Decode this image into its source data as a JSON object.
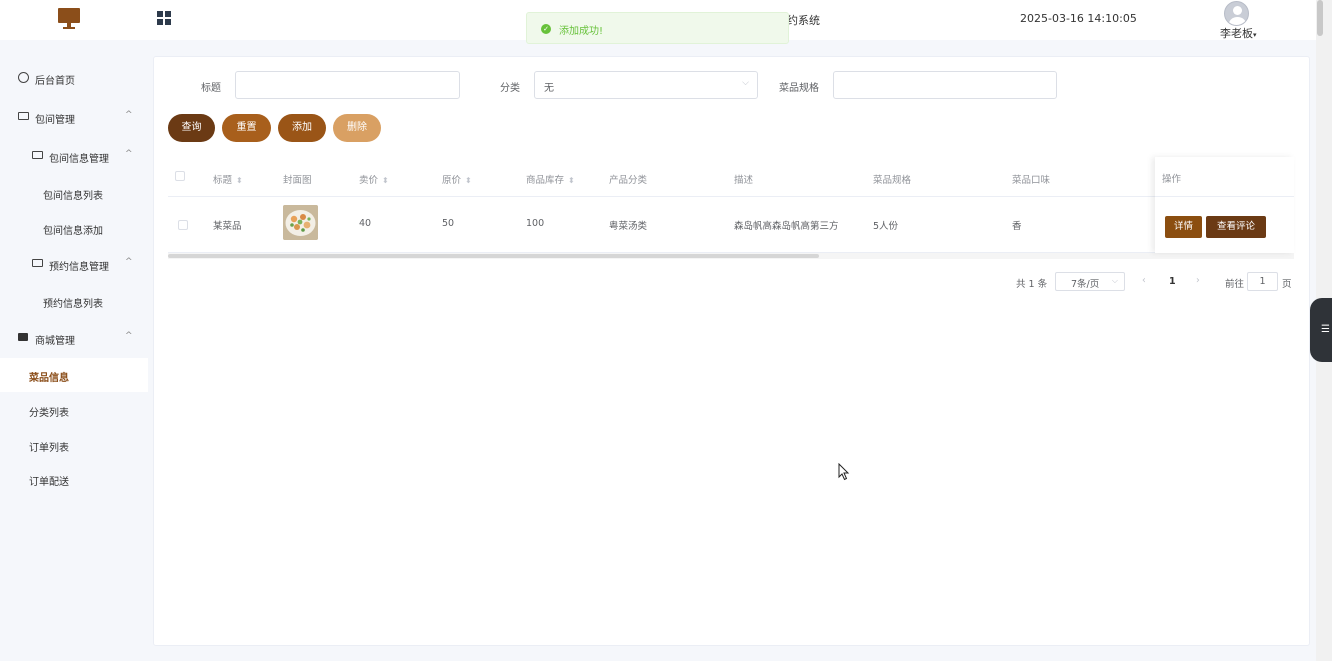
{
  "header": {
    "system_title": "约系统",
    "datetime": "2025-03-16 14:10:05",
    "username": "李老板",
    "toast": "添加成功!"
  },
  "sidebar": {
    "items": [
      {
        "label": "后台首页",
        "icon": "clock-icon"
      },
      {
        "label": "包间管理",
        "icon": "room-icon"
      },
      {
        "label": "包间信息管理",
        "icon": "info-icon"
      },
      {
        "label": "包间信息列表"
      },
      {
        "label": "包间信息添加"
      },
      {
        "label": "预约信息管理",
        "icon": "info-icon"
      },
      {
        "label": "预约信息列表"
      },
      {
        "label": "商城管理",
        "icon": "shop-icon"
      },
      {
        "label": "菜品信息",
        "active": true
      },
      {
        "label": "分类列表"
      },
      {
        "label": "订单列表"
      },
      {
        "label": "订单配送"
      }
    ]
  },
  "filters": {
    "title_label": "标题",
    "title_value": "",
    "category_label": "分类",
    "category_value": "无",
    "spec_label": "菜品规格",
    "spec_value": ""
  },
  "buttons": {
    "query": "查询",
    "reset": "重置",
    "add": "添加",
    "delete": "删除"
  },
  "table": {
    "columns": [
      "标题",
      "封面图",
      "卖价",
      "原价",
      "商品库存",
      "产品分类",
      "描述",
      "菜品规格",
      "菜品口味",
      "操作"
    ],
    "rows": [
      {
        "title": "某菜品",
        "price": "40",
        "original_price": "50",
        "stock": "100",
        "category": "粤菜汤类",
        "description": "森岛帆高森岛帆高第三方",
        "spec": "5人份",
        "flavor": "香",
        "actions": {
          "detail": "详情",
          "reviews": "查看评论"
        }
      }
    ]
  },
  "pagination": {
    "total": "共 1 条",
    "page_size": "7条/页",
    "current_page": "1",
    "goto_label": "前往",
    "goto_value": "1",
    "page_suffix": "页"
  },
  "colors": {
    "brand_dark": "#6b3a14",
    "brand": "#9a5517",
    "brand_light": "#d9a063",
    "success": "#67c23a"
  }
}
